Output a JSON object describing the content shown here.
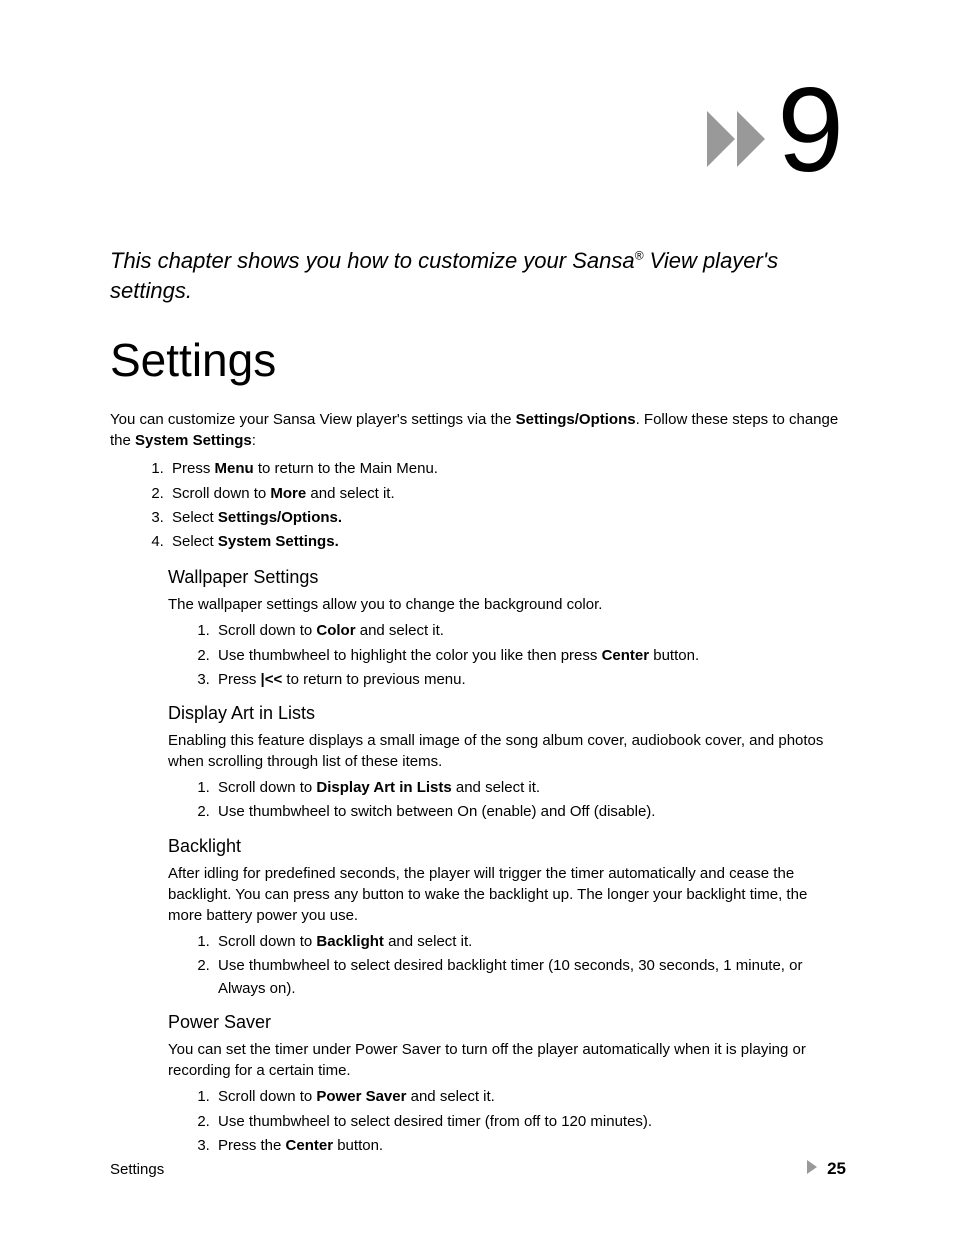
{
  "chapter": {
    "number": "9",
    "intro_html": "This chapter shows you how to customize your Sansa<sup>®</sup> View player's settings."
  },
  "title": "Settings",
  "intro_paragraph_html": "You can customize your Sansa View player's settings via the <b>Settings/Options</b>.  Follow these steps to change the <b>System Settings</b>:",
  "main_steps": [
    "Press <b>Menu</b> to return to the Main Menu.",
    "Scroll down to <b>More</b> and select it.",
    "Select <b>Settings/Options.</b>",
    "Select <b>System Settings.</b>"
  ],
  "sections": [
    {
      "heading": "Wallpaper Settings",
      "paragraph": "The wallpaper settings allow you to change the background color.",
      "steps": [
        "Scroll down to <b>Color</b> and select it.",
        "Use thumbwheel to highlight the color you like then press <b>Center</b> button.",
        "Press <b>|&lt;&lt;</b> to return to previous menu."
      ]
    },
    {
      "heading": "Display Art in Lists",
      "paragraph": "Enabling this feature displays a small image of the song album cover, audiobook cover, and photos when scrolling through list of these items.",
      "steps": [
        "Scroll down to <b>Display Art in Lists</b> and select it.",
        "Use thumbwheel to switch between On (enable) and Off (disable)."
      ]
    },
    {
      "heading": "Backlight",
      "paragraph": "After idling for predefined seconds, the player will trigger the timer automatically and cease the backlight.  You can press any button to wake the backlight up.  The longer your backlight time, the more battery power you use.",
      "steps": [
        "Scroll down to <b>Backlight</b> and select it.",
        "Use thumbwheel to select desired backlight timer (10 seconds, 30 seconds, 1 minute, or Always on)."
      ]
    },
    {
      "heading": "Power Saver",
      "paragraph": "You can set the timer under Power Saver to turn off the player automatically when it is playing or recording for a certain time.",
      "steps": [
        "Scroll down to <b>Power Saver</b> and select it.",
        "Use thumbwheel to select desired timer (from off to 120 minutes).",
        "Press the <b>Center</b> button."
      ]
    }
  ],
  "footer": {
    "left": "Settings",
    "page_number": "25"
  }
}
